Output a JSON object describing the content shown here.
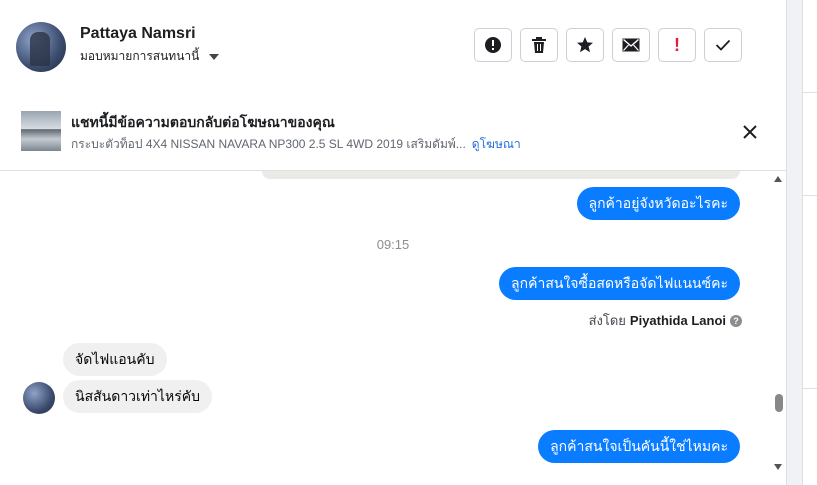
{
  "header": {
    "contact_name": "Pattaya Namsri",
    "assign_label": "มอบหมายการสนทนานี้",
    "actions": [
      {
        "name": "report-icon",
        "label": ""
      },
      {
        "name": "trash-icon",
        "label": ""
      },
      {
        "name": "star-icon",
        "label": ""
      },
      {
        "name": "envelope-icon",
        "label": ""
      },
      {
        "name": "mark-important-icon",
        "label": "!"
      },
      {
        "name": "check-icon",
        "label": ""
      }
    ]
  },
  "ad_banner": {
    "title": "แชทนี้มีข้อความตอบกลับต่อโฆษณาของคุณ",
    "description": "กระบะตัวท็อป 4X4 NISSAN NAVARA NP300 2.5 SL 4WD 2019 เสริมดัมพ์...",
    "link": "ดูโฆษณา"
  },
  "messages": {
    "out_1": "ลูกค้าอยู่จังหวัดอะไรคะ",
    "timestamp": "09:15",
    "out_2": "ลูกค้าสนใจซื้อสดหรือจัดไฟแนนซ์คะ",
    "sent_by_prefix": "ส่งโดย",
    "sent_by_name": "Piyathida Lanoi",
    "in_1": "จัดไฟแอนคับ",
    "in_2": "นิสสันดาวเท่าไหร่คับ",
    "out_3": "ลูกค้าสนใจเป็นคันนี้ใช่ไหมคะ"
  },
  "colors": {
    "outgoing_bubble": "#0a7cff",
    "incoming_bubble": "#f0f0f0",
    "link": "#216fdb",
    "important": "#e41e3f"
  }
}
